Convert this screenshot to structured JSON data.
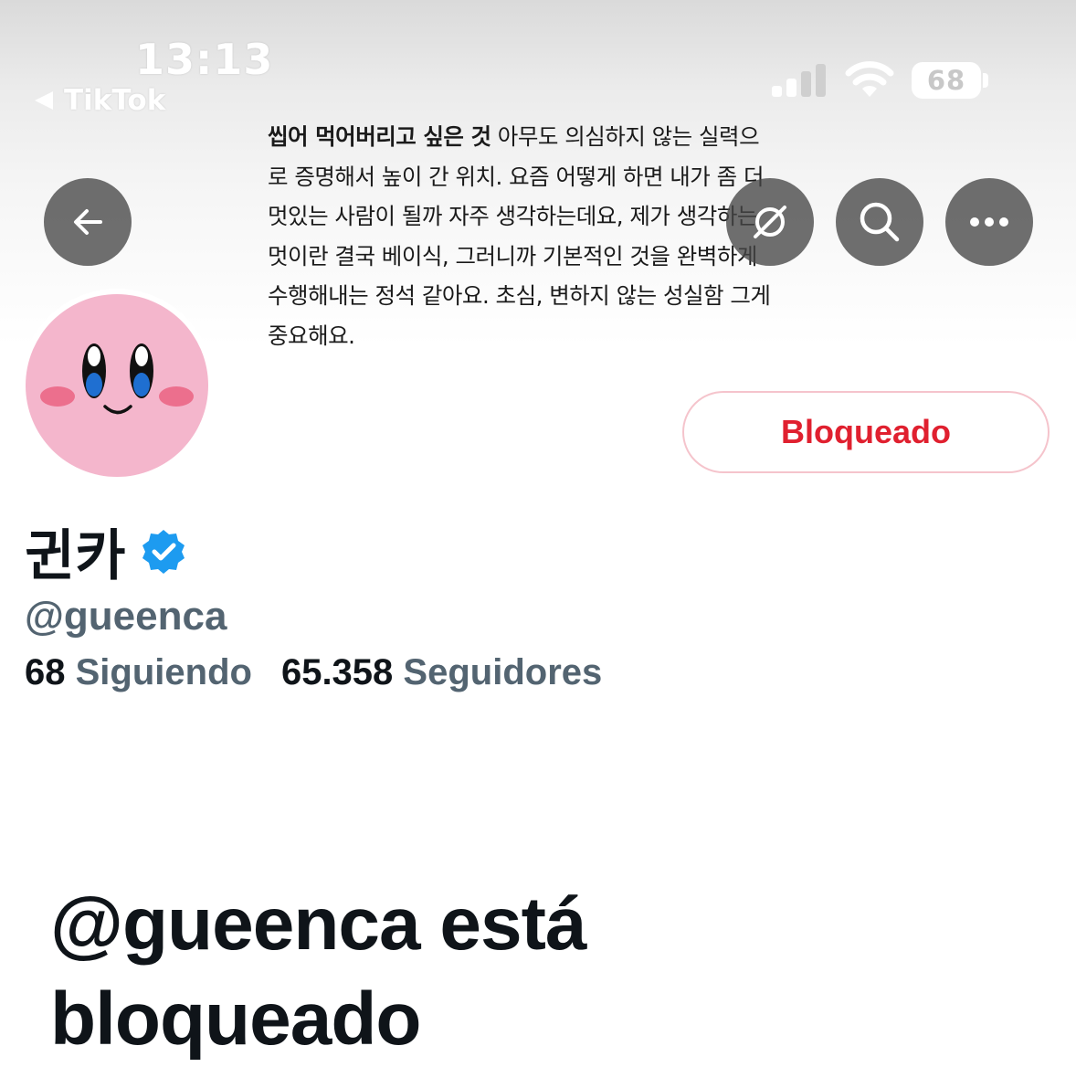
{
  "status_bar": {
    "time": "13:13",
    "back_app": "TikTok",
    "battery": "68"
  },
  "banner": {
    "lines": [
      {
        "bold": "씹어 먹어버리고 싶은 것",
        "text": " 아무도 의심하지 않는 실력으"
      },
      {
        "bold": "",
        "text": "로 증명해서 높이 간 위치. 요즘 어떻게 하면 내가 좀 더"
      },
      {
        "bold": "",
        "text": "멋있는 사람이 될까 자주 생각하는데요, 제가 생각하는"
      },
      {
        "bold": "",
        "text": "멋이란 결국 베이식, 그러니까 기본적인 것을 완벽하게"
      },
      {
        "bold": "",
        "text": "수행해내는 정석 같아요. 초심, 변하지 않는 성실함 그게"
      },
      {
        "bold": "",
        "text": "중요해요."
      }
    ]
  },
  "nav": {
    "back_icon": "arrow-left-icon",
    "grok_icon": "grok-icon",
    "search_icon": "search-icon",
    "more_icon": "more-icon"
  },
  "profile": {
    "display_name": "귄카",
    "handle": "@gueenca",
    "following_count": "68",
    "following_label": "Siguiendo",
    "followers_count": "65.358",
    "followers_label": "Seguidores",
    "blocked_button": "Bloqueado",
    "blocked_message": "@gueenca está bloqueado"
  },
  "colors": {
    "accent_red": "#e0202f",
    "text_primary": "#0f1419",
    "text_secondary": "#536471",
    "verified_blue": "#1d9bf0",
    "avatar_pink": "#f4b6cc"
  }
}
